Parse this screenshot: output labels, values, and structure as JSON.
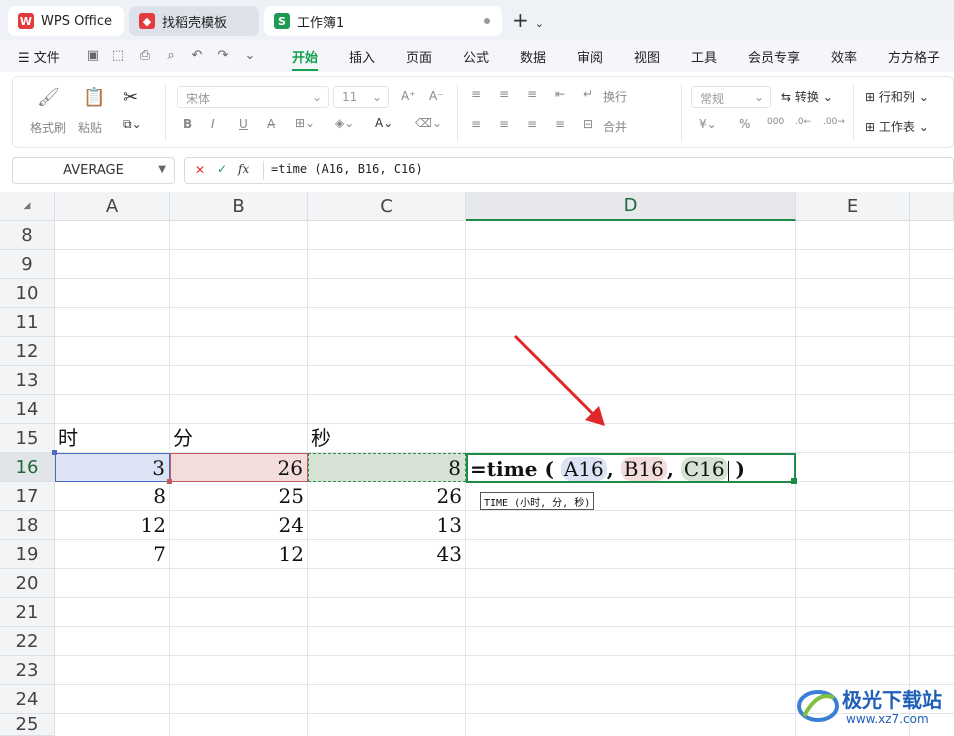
{
  "tabs": [
    {
      "label": "WPS Office",
      "logo": "W"
    },
    {
      "label": "找稻壳模板",
      "logo": "◆"
    },
    {
      "label": "工作簿1",
      "logo": "S"
    }
  ],
  "menu": {
    "file": "文件",
    "items": [
      "开始",
      "插入",
      "页面",
      "公式",
      "数据",
      "审阅",
      "视图",
      "工具",
      "会员专享",
      "效率",
      "方方格子"
    ]
  },
  "ribbon": {
    "format_painter": "格式刷",
    "paste": "粘贴",
    "font_name": "宋体",
    "font_size": "11",
    "wrap": "换行",
    "merge": "合并",
    "number_format": "常规",
    "convert": "转换",
    "row_col": "行和列",
    "worksheet": "工作表",
    "bold": "B",
    "italic": "I",
    "underline": "U",
    "strike": "A̶"
  },
  "namebox": {
    "value": "AVERAGE"
  },
  "formula_bar": {
    "cancel": "✕",
    "confirm": "✓",
    "fx": "fx",
    "value": "=time (A16, B16, C16)"
  },
  "columns": [
    "A",
    "B",
    "C",
    "D",
    "E"
  ],
  "rows": [
    "8",
    "9",
    "10",
    "11",
    "12",
    "13",
    "14",
    "15",
    "16",
    "17",
    "18",
    "19",
    "20",
    "21",
    "22",
    "23",
    "24",
    "25"
  ],
  "cells": {
    "A15": "时",
    "B15": "分",
    "C15": "秒",
    "A16": "3",
    "B16": "26",
    "C16": "8",
    "A17": "8",
    "B17": "25",
    "C17": "26",
    "A18": "12",
    "B18": "24",
    "C18": "13",
    "A19": "7",
    "B19": "12",
    "C19": "43"
  },
  "formula_cell": {
    "prefix": "=time (",
    "ref1": "A16",
    "sep1": ",",
    "ref2": "B16",
    "sep2": ",",
    "ref3": "C16",
    "suffix": ")"
  },
  "tooltip": "TIME (小时, 分, 秒)",
  "watermark": {
    "brand": "极光下载站",
    "url": "www.xz7.com"
  },
  "colors": {
    "accent": "#14a050",
    "ref_a": "#dbe3f5",
    "ref_b": "#f2dcdc",
    "ref_c": "#d6e2d3",
    "arrow": "#e0282a"
  }
}
